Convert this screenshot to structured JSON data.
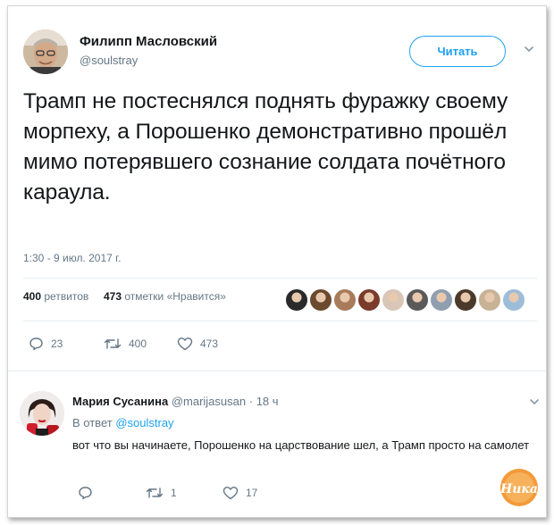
{
  "tweet": {
    "author_name": "Филипп Масловский",
    "author_handle": "@soulstray",
    "follow_label": "Читать",
    "text": "Трамп не постеснялся поднять фуражку своему морпеху, а Порошенко демонстративно прошёл мимо потерявшего сознание солдата почётного караула.",
    "timestamp": "1:30 - 9 июл. 2017 г.",
    "retweets_count": "400",
    "retweets_label": "ретвитов",
    "likes_count": "473",
    "likes_label": "отметки «Нравится»",
    "actions": {
      "replies": "23",
      "retweets": "400",
      "likes": "473"
    },
    "liker_colors": [
      "#2a2a2a",
      "#6b4a2e",
      "#a87b5a",
      "#7a3b2a",
      "#d9c6b8",
      "#5a5a5a",
      "#8f9fb0",
      "#4b3a2a",
      "#c7b296",
      "#9dbcd8"
    ]
  },
  "reply": {
    "author_name": "Мария Сусанина",
    "author_handle": "@marijasusan",
    "time": "18 ч",
    "in_reply_prefix": "В ответ",
    "in_reply_handle": "@soulstray",
    "text": "вот что вы начинаете, Порошенко на царствование шел, а Трамп просто на самолет",
    "actions": {
      "replies": "",
      "retweets": "1",
      "likes": "17"
    }
  },
  "watermark": {
    "text": "Ника"
  },
  "colors": {
    "accent": "#1da1f2",
    "muted": "#657786",
    "text": "#14171a",
    "divider": "#e6ecf0"
  }
}
